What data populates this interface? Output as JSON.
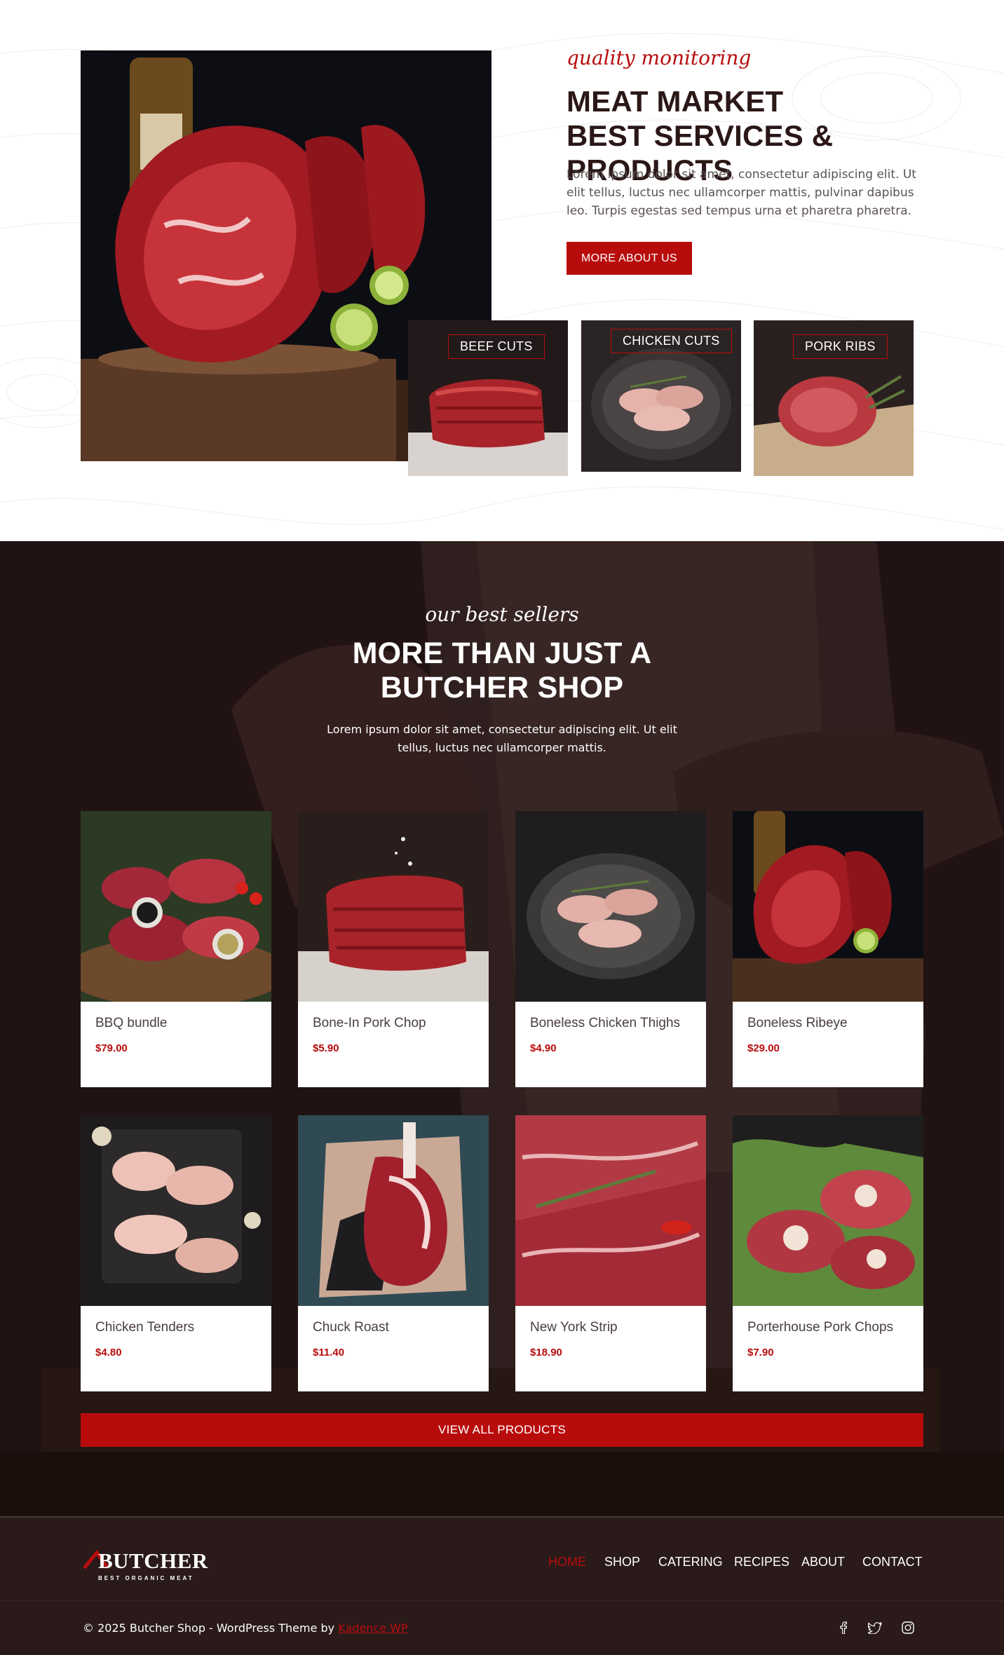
{
  "intro": {
    "kicker": "quality monitoring",
    "title": "MEAT MARKET BEST SERVICES & PRODUCTS",
    "text": "Lorem ipsum dolor sit amet, consectetur adipiscing elit. Ut elit tellus, luctus nec ullamcorper mattis, pulvinar dapibus leo. Turpis egestas sed tempus urna et pharetra pharetra.",
    "button": "MORE ABOUT US",
    "categories": [
      {
        "label": "BEEF CUTS"
      },
      {
        "label": "CHICKEN CUTS"
      },
      {
        "label": "PORK RIBS"
      }
    ]
  },
  "bestsellers": {
    "kicker": "our best sellers",
    "title": "MORE THAN JUST A BUTCHER SHOP",
    "text": "Lorem ipsum dolor sit amet, consectetur adipiscing elit. Ut elit tellus, luctus nec ullamcorper mattis.",
    "products": [
      {
        "name": "BBQ bundle",
        "price": "$79.00"
      },
      {
        "name": "Bone-In Pork Chop",
        "price": "$5.90"
      },
      {
        "name": "Boneless Chicken Thighs",
        "price": "$4.90"
      },
      {
        "name": "Boneless Ribeye",
        "price": "$29.00"
      },
      {
        "name": "Chicken Tenders",
        "price": "$4.80"
      },
      {
        "name": "Chuck Roast",
        "price": "$11.40"
      },
      {
        "name": "New York Strip",
        "price": "$18.90"
      },
      {
        "name": "Porterhouse Pork Chops",
        "price": "$7.90"
      }
    ],
    "button": "VIEW ALL PRODUCTS"
  },
  "footer": {
    "logo": {
      "word": "BUTCHER",
      "tagline": "BEST ORGANIC MEAT"
    },
    "nav": [
      {
        "label": "HOME"
      },
      {
        "label": "SHOP"
      },
      {
        "label": "CATERING"
      },
      {
        "label": "RECIPES"
      },
      {
        "label": "ABOUT"
      },
      {
        "label": "CONTACT"
      }
    ],
    "copyright": "© 2025 Butcher Shop - WordPress Theme by",
    "credit_link": "Kadence WP",
    "social": [
      "facebook-icon",
      "twitter-icon",
      "instagram-icon"
    ]
  },
  "colors": {
    "accent": "#b80c0c",
    "dark": "#2a1919",
    "heading": "#2b1717"
  }
}
